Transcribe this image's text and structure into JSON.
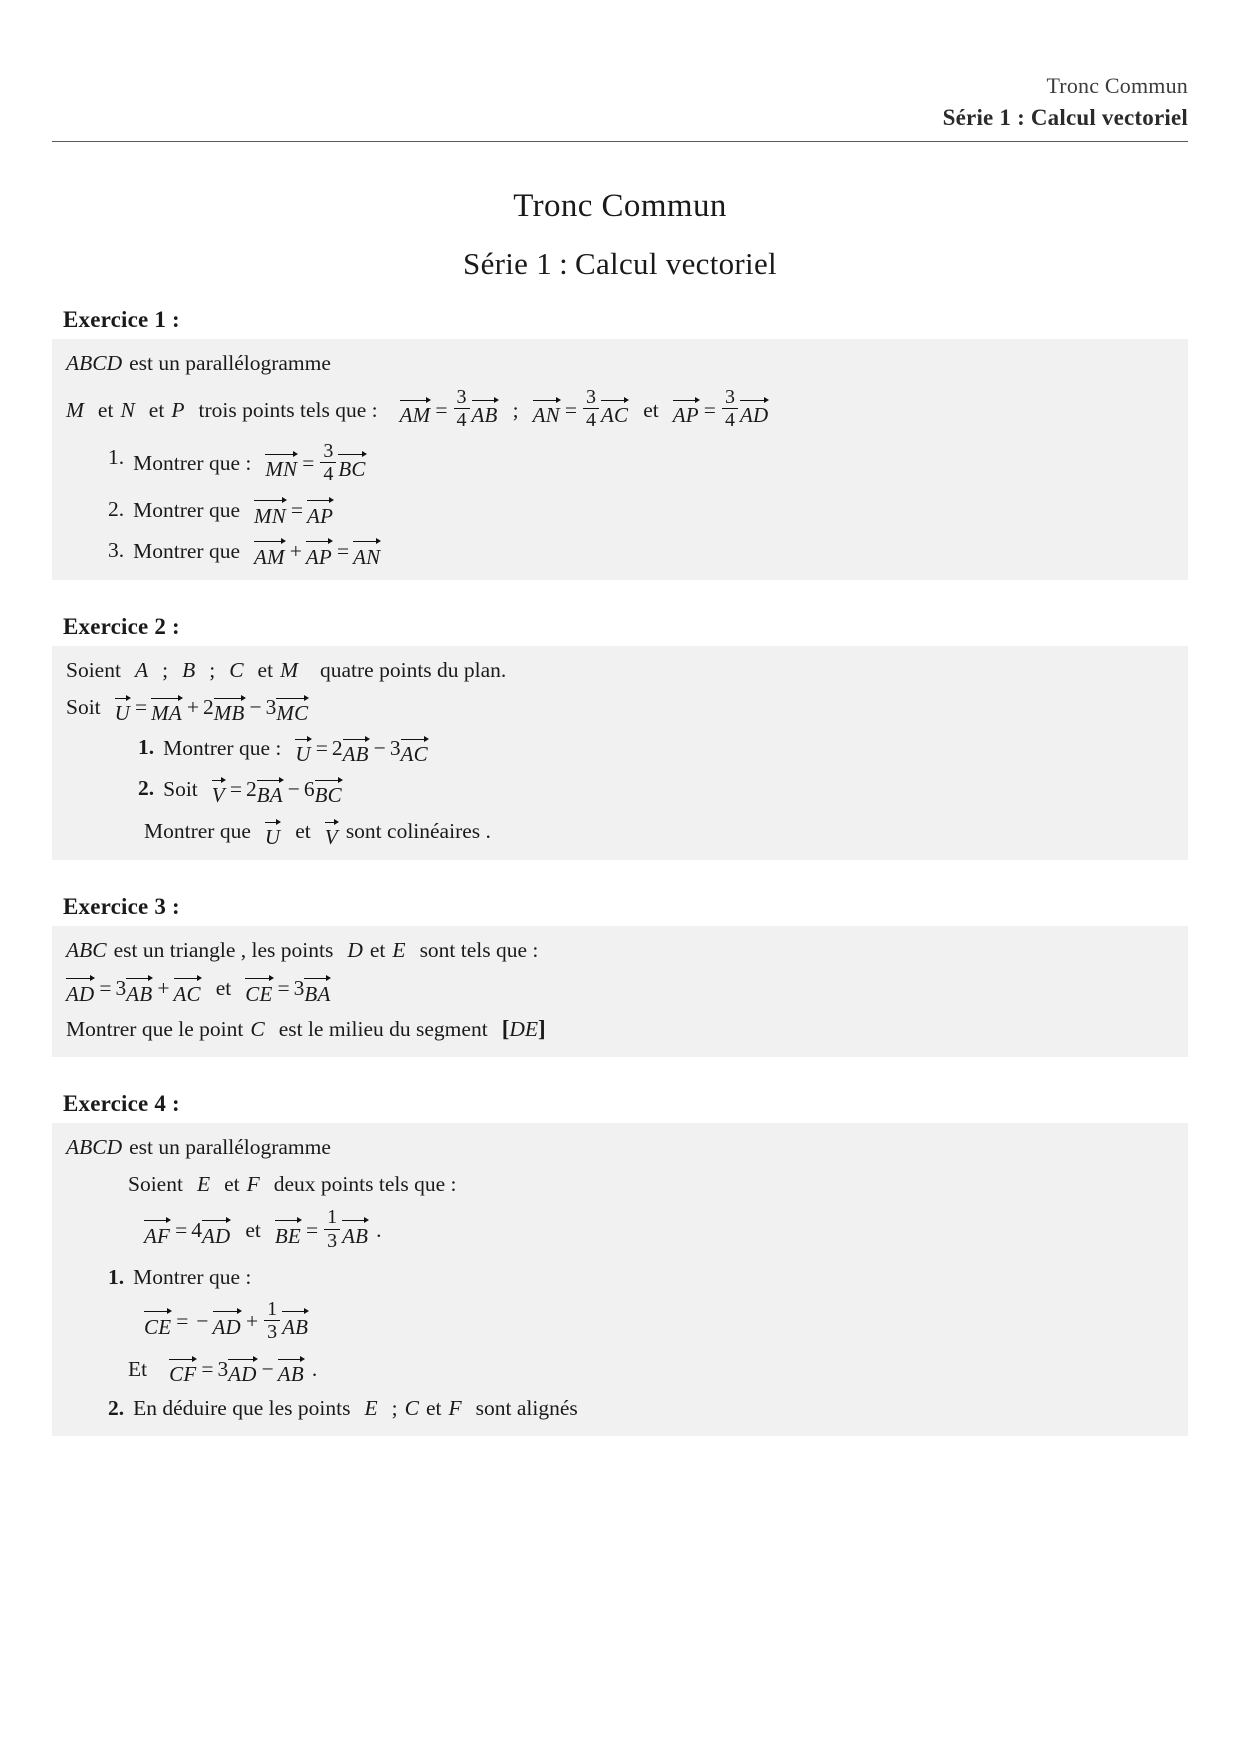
{
  "header": {
    "line1": "Tronc Commun",
    "line2": "Série 1 : Calcul vectoriel"
  },
  "title": "Tronc Commun",
  "subtitle_part1": "Série 1",
  "subtitle_sep": ":",
  "subtitle_part2": "Calcul vectoriel",
  "exercises": [
    {
      "heading": "Exercice 1 :",
      "intro_points": "ABCD",
      "intro_text": "est un parallélogramme",
      "line2": {
        "p1": "M",
        "et1": "et",
        "p2": "N",
        "et2": "et",
        "p3": "P",
        "text": "trois points tels que :",
        "eq1": {
          "lhs": "AM",
          "eqsign": "=",
          "num": "3",
          "den": "4",
          "rhs": "AB"
        },
        "sep1": ";",
        "eq2": {
          "lhs": "AN",
          "eqsign": "=",
          "num": "3",
          "den": "4",
          "rhs": "AC"
        },
        "et3": "et",
        "eq3": {
          "lhs": "AP",
          "eqsign": "=",
          "num": "3",
          "den": "4",
          "rhs": "AD"
        }
      },
      "items": [
        {
          "num": "1.",
          "text": "Montrer que :",
          "lhs": "MN",
          "eqsign": "=",
          "num_f": "3",
          "den_f": "4",
          "rhs": "BC"
        },
        {
          "num": "2.",
          "text": "Montrer que",
          "lhs": "MN",
          "eqsign": "=",
          "rhs": "AP"
        },
        {
          "num": "3.",
          "text": "Montrer que",
          "lhs": "AM",
          "plus": "+",
          "mid": "AP",
          "eqsign": "=",
          "rhs": "AN"
        }
      ]
    },
    {
      "heading": "Exercice 2 :",
      "line1": {
        "soient": "Soient",
        "a": "A",
        "s1": ";",
        "b": "B",
        "s2": ";",
        "c": "C",
        "et": "et",
        "m": "M",
        "tail": "quatre points du plan."
      },
      "line2": {
        "soit": "Soit",
        "u": "U",
        "eqsign": "=",
        "v1": "MA",
        "plus": "+",
        "c2": "2",
        "v2": "MB",
        "minus": "−",
        "c3": "3",
        "v3": "MC"
      },
      "items": [
        {
          "num": "1.",
          "text": "Montrer que :",
          "u": "U",
          "eqsign": "=",
          "c1": "2",
          "v1": "AB",
          "minus": "−",
          "c2": "3",
          "v2": "AC"
        },
        {
          "num": "2.",
          "text": "Soit",
          "v": "V",
          "eqsign": "=",
          "c1": "2",
          "v1": "BA",
          "minus": "−",
          "c2": "6",
          "v2": "BC"
        }
      ],
      "conclusion": {
        "pre": "Montrer que",
        "u": "U",
        "et": "et",
        "v": "V",
        "post": "sont colinéaires ."
      }
    },
    {
      "heading": "Exercice 3 :",
      "line1": {
        "abc": "ABC",
        "t1": "est un triangle , les points",
        "d": "D",
        "et": "et",
        "e": "E",
        "t2": "sont tels que :"
      },
      "line2": {
        "lhs": "AD",
        "eqsign": "=",
        "c1": "3",
        "v1": "AB",
        "plus": "+",
        "v2": "AC",
        "et": "et",
        "lhs2": "CE",
        "eqsign2": "=",
        "c2": "3",
        "v3": "BA"
      },
      "line3": {
        "pre": "Montrer que le point",
        "c": "C",
        "mid": "est le milieu du segment",
        "open": "[",
        "seg": "DE",
        "close": "]"
      }
    },
    {
      "heading": "Exercice 4 :",
      "intro_points": "ABCD",
      "intro_text": "est un parallélogramme",
      "line2": {
        "soient": "Soient",
        "e": "E",
        "et": "et",
        "f": "F",
        "tail": "deux points tels que :"
      },
      "line3": {
        "lhs": "AF",
        "eqsign": "=",
        "c1": "4",
        "v1": "AD",
        "et": "et",
        "lhs2": "BE",
        "eqsign2": "=",
        "num": "1",
        "den": "3",
        "v2": "AB",
        "period": "."
      },
      "items": [
        {
          "num": "1.",
          "text": "Montrer que :"
        },
        {
          "num": "2.",
          "text_pre": "En déduire que les points",
          "e": "E",
          "s": ";",
          "c": "C",
          "et": "et",
          "f": "F",
          "text_post": "sont alignés"
        }
      ],
      "eq_ce": {
        "lhs": "CE",
        "eqsign": "=",
        "minus": "−",
        "v1": "AD",
        "plus": "+",
        "num": "1",
        "den": "3",
        "v2": "AB"
      },
      "eq_cf": {
        "et": "Et",
        "lhs": "CF",
        "eqsign": "=",
        "c1": "3",
        "v1": "AD",
        "minus": "−",
        "v2": "AB",
        "period": "."
      }
    }
  ]
}
